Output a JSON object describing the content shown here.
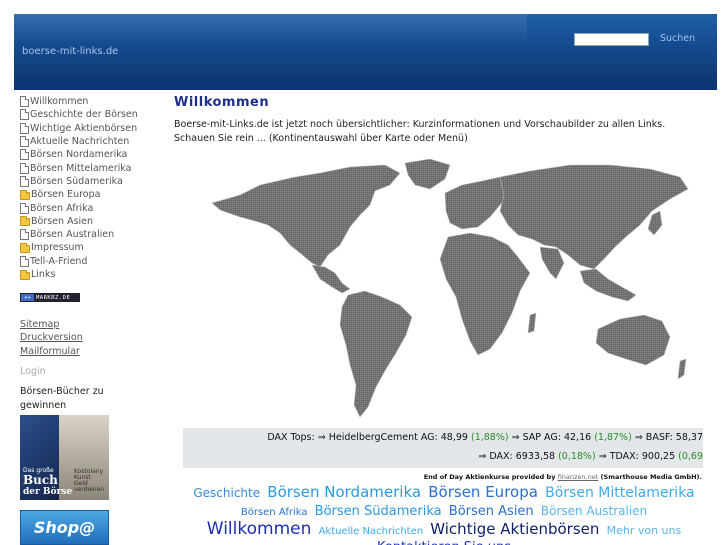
{
  "header": {
    "site_name": "boerse-mit-links.de",
    "search_placeholder": "",
    "search_button": "Suchen"
  },
  "sidebar": {
    "items": [
      {
        "label": "Willkommen",
        "icon": "page-icon"
      },
      {
        "label": "Geschichte der Börsen",
        "icon": "page-icon"
      },
      {
        "label": "Wichtige Aktienbörsen",
        "icon": "page-icon"
      },
      {
        "label": "Aktuelle Nachrichten",
        "icon": "page-icon"
      },
      {
        "label": "Börsen Nordamerika",
        "icon": "page-icon"
      },
      {
        "label": "Börsen Mittelamerika",
        "icon": "page-icon"
      },
      {
        "label": "Börsen Südamerika",
        "icon": "page-icon"
      },
      {
        "label": "Börsen Europa",
        "icon": "folder-icon"
      },
      {
        "label": "Börsen Afrika",
        "icon": "page-icon"
      },
      {
        "label": "Börsen Asien",
        "icon": "folder-icon"
      },
      {
        "label": "Börsen Australien",
        "icon": "page-icon"
      },
      {
        "label": "Impressum",
        "icon": "folder-icon"
      },
      {
        "label": "Tell-A-Friend",
        "icon": "page-icon"
      },
      {
        "label": "Links",
        "icon": "folder-icon"
      }
    ],
    "badge_text": "MARKRZ.DE",
    "sitemap": "Sitemap",
    "druckversion": "Druckversion",
    "mailformular": "Mailformular",
    "login": "Login",
    "books_title": "Börsen-Bücher zu gewinnen",
    "book": {
      "line1": "Das große",
      "line2": "Buch",
      "line3": "der Börse",
      "line4": "Kostolany Kunst Geld verdienen"
    },
    "shop_label": "Shop@"
  },
  "main": {
    "title": "Willkommen",
    "intro": "Boerse-mit-Links.de  ist jetzt noch übersichtlicher: Kurzinformationen und Vorschaubilder zu allen Links. Schauen Sie rein ...  (Kontinentauswahl über Karte oder Menü)"
  },
  "ticker": {
    "row1": {
      "prefix": "DAX Tops: ",
      "items": [
        {
          "name": "HeidelbergCement AG:",
          "value": "48,99",
          "change": "(1,88%)"
        },
        {
          "name": "SAP AG:",
          "value": "42,16",
          "change": "(1,87%)"
        },
        {
          "name": "BASF:",
          "value": "58,37",
          "change": ""
        }
      ]
    },
    "row2": {
      "items": [
        {
          "name": "DAX:",
          "value": "6933,58",
          "change": "(0,18%)"
        },
        {
          "name": "TDAX:",
          "value": "900,25",
          "change": "(0,69"
        }
      ]
    },
    "arrow": "⇒"
  },
  "credit": {
    "prefix": "End of Day Aktienkurse provided by ",
    "link": "finanzen.net",
    "suffix": " (Smarthouse Media GmbH)."
  },
  "tags": [
    {
      "text": "Geschichte",
      "size": 12,
      "color": "#3a8ad6"
    },
    {
      "text": "Börsen Nordamerika",
      "size": 15,
      "color": "#2a9ae0"
    },
    {
      "text": "Börsen Europa",
      "size": 15,
      "color": "#2a70cc"
    },
    {
      "text": "Börsen Mittelamerika",
      "size": 14,
      "color": "#3fa9e8"
    },
    {
      "text": "Börsen Afrika",
      "size": 10,
      "color": "#2a70cc"
    },
    {
      "text": "Börsen Südamerika",
      "size": 13,
      "color": "#2a9ae0"
    },
    {
      "text": "Börsen Asien",
      "size": 13,
      "color": "#2a70cc"
    },
    {
      "text": "Börsen Australien",
      "size": 12,
      "color": "#5ab4ec"
    },
    {
      "text": "Willkommen",
      "size": 17,
      "color": "#1c2fb0"
    },
    {
      "text": "Aktuelle Nachrichten",
      "size": 10,
      "color": "#3fa9e8"
    },
    {
      "text": "Wichtige Aktienbörsen",
      "size": 15,
      "color": "#0e1f6c"
    },
    {
      "text": "Mehr von uns",
      "size": 11,
      "color": "#5ab4ec"
    },
    {
      "text": "Kontaktieren Sie uns",
      "size": 13,
      "color": "#2233b8"
    }
  ],
  "colors": {
    "header": "#14498c",
    "title": "#1e2f8c",
    "positive": "#2a8a2a",
    "map": "#707070"
  }
}
